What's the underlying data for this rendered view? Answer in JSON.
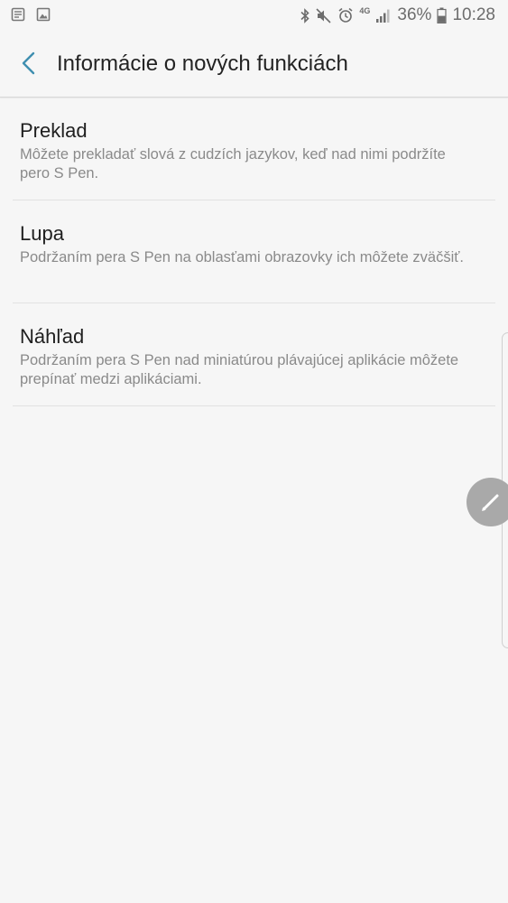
{
  "status_bar": {
    "left_icons": [
      "notes-icon",
      "image-icon"
    ],
    "right_icons": [
      "bluetooth-icon",
      "mute-icon",
      "alarm-icon"
    ],
    "network_label": "4G",
    "battery_percent": "36%",
    "time": "10:28"
  },
  "header": {
    "title": "Informácie o nových funkciách",
    "back_icon": "chevron-left-icon",
    "accent_color": "#3f8fb0"
  },
  "items": [
    {
      "title": "Preklad",
      "description": "Môžete prekladať slová z cudzích jazykov, keď nad nimi podržíte pero S Pen."
    },
    {
      "title": "Lupa",
      "description": "Podržaním pera S Pen na oblasťami obrazovky ich môžete zväčšiť."
    },
    {
      "title": "Náhľad",
      "description": "Podržaním pera S Pen nad miniatúrou plávajúcej aplikácie môžete prepínať medzi aplikáciami."
    }
  ],
  "floating": {
    "icon": "pen-icon"
  }
}
